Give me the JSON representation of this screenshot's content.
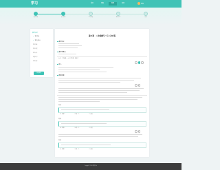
{
  "header": {
    "logo": "学习",
    "nav": [
      "首页",
      "课程",
      "备课",
      "资源"
    ],
    "active_nav": 2,
    "user_name": "老师"
  },
  "steps": {
    "labels": [
      "选择教材",
      "设计教案",
      "互动课堂",
      "课后作业",
      "完成"
    ],
    "current": 1
  },
  "sidebar": {
    "title": "教学设计",
    "items": [
      {
        "label": "教学目标",
        "checked": true
      },
      {
        "label": "教学重难点",
        "checked": true
      },
      {
        "label": "教学准备",
        "checked": false
      },
      {
        "label": "教学过程",
        "checked": false
      },
      {
        "label": "板书设计",
        "checked": false
      },
      {
        "label": "课堂练习",
        "checked": false
      },
      {
        "label": "课后反思",
        "checked": false
      }
    ],
    "button": "保存教案"
  },
  "main": {
    "title": "第21课　二次函数与一元二次方程",
    "sections": [
      "教学目标",
      "教学重难点",
      "导入",
      "新授讲解"
    ],
    "tag_text": "重点：二次函数、一元二次方程、判别式",
    "questions": [
      {
        "label": "例题1",
        "options": [
          "A. 有两个",
          "B. 有一个",
          "C. 没有"
        ]
      },
      {
        "label": "例题2",
        "options": [
          "A. 有两个",
          "B. 有一个",
          "C. 没有"
        ]
      },
      {
        "label": "例题3",
        "options": [
          "A. 有两个",
          "B. 有一个",
          "C. 没有"
        ]
      }
    ]
  },
  "footer": {
    "text": "Copyright © 2016 教学平台"
  },
  "colors": {
    "accent": "#3fc3b6",
    "footer": "#3c3c3c"
  }
}
